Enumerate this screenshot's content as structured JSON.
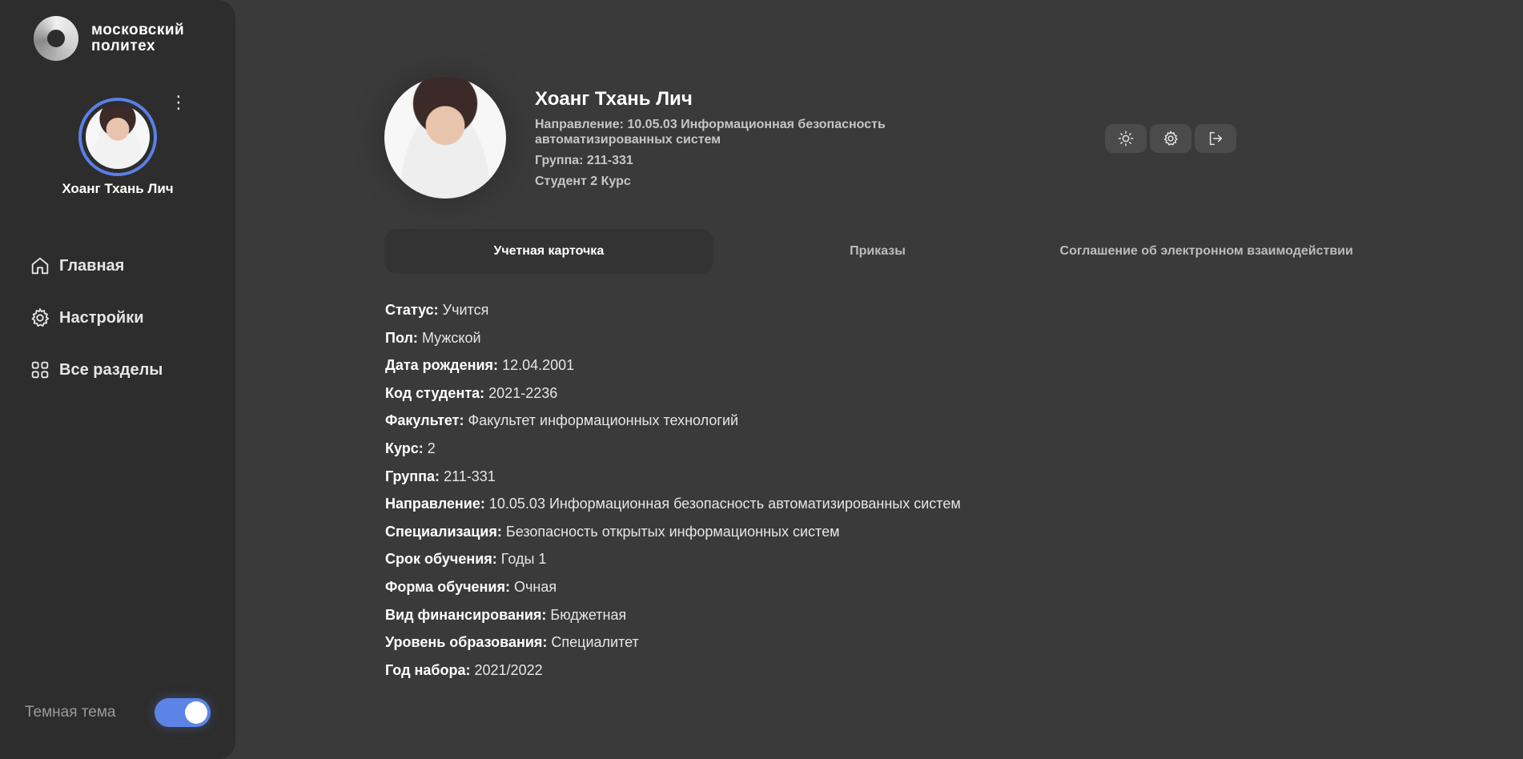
{
  "brand": {
    "line1": "московский",
    "line2": "политех"
  },
  "sidebar": {
    "user_name": "Хоанг Тхань Лич",
    "nav": [
      {
        "label": "Главная",
        "icon": "home-icon"
      },
      {
        "label": "Настройки",
        "icon": "gear-icon"
      },
      {
        "label": "Все разделы",
        "icon": "grid-icon"
      }
    ],
    "theme_label": "Темная тема",
    "dark_theme_on": true
  },
  "profile": {
    "name": "Хоанг Тхань Лич",
    "direction": "Направление: 10.05.03 Информационная безопасность автоматизированных систем",
    "group": "Группа: 211-331",
    "course": "Студент 2 Курс"
  },
  "toolbar": {
    "icons": [
      "sun-icon",
      "gear-icon",
      "logout-icon"
    ]
  },
  "tabs": [
    {
      "label": "Учетная карточка",
      "active": true
    },
    {
      "label": "Приказы",
      "active": false
    },
    {
      "label": "Соглашение об электронном взаимодействии",
      "active": false
    }
  ],
  "fields": [
    {
      "key": "Статус:",
      "value": "Учится"
    },
    {
      "key": "Пол:",
      "value": "Мужской"
    },
    {
      "key": "Дата рождения:",
      "value": "12.04.2001"
    },
    {
      "key": "Код студента:",
      "value": "2021-2236"
    },
    {
      "key": "Факультет:",
      "value": "Факультет информационных технологий"
    },
    {
      "key": "Курс:",
      "value": "2"
    },
    {
      "key": "Группа:",
      "value": "211-331"
    },
    {
      "key": "Направление:",
      "value": "10.05.03 Информационная безопасность автоматизированных систем"
    },
    {
      "key": "Специализация:",
      "value": "Безопасность открытых информационных систем"
    },
    {
      "key": "Срок обучения:",
      "value": "Годы 1"
    },
    {
      "key": "Форма обучения:",
      "value": "Очная"
    },
    {
      "key": "Вид финансирования:",
      "value": "Бюджетная"
    },
    {
      "key": "Уровень образования:",
      "value": "Специалитет"
    },
    {
      "key": "Год набора:",
      "value": "2021/2022"
    }
  ]
}
